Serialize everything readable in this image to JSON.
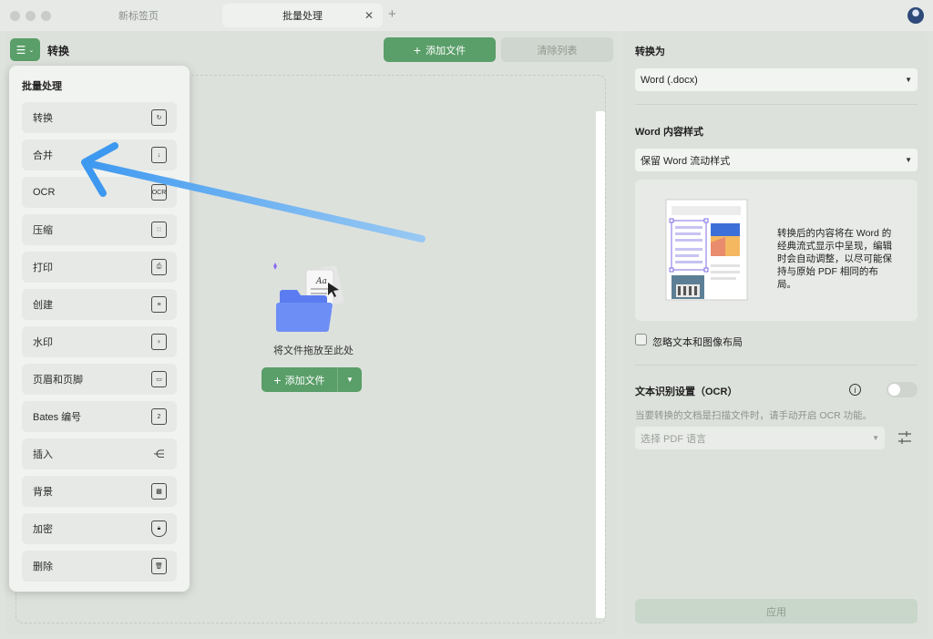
{
  "titlebar": {
    "tabs": [
      {
        "label": "新标签页",
        "active": false
      },
      {
        "label": "批量处理",
        "active": true
      }
    ]
  },
  "toolbar": {
    "title": "转换",
    "add_files_label": "添加文件",
    "clear_list_label": "清除列表"
  },
  "dropzone": {
    "hint": "将文件拖放至此处",
    "add_files_label": "添加文件"
  },
  "menu": {
    "heading": "批量处理",
    "items": [
      {
        "label": "转换",
        "icon": "convert-icon"
      },
      {
        "label": "合并",
        "icon": "merge-icon"
      },
      {
        "label": "OCR",
        "icon": "ocr-icon",
        "icon_text": "OCR"
      },
      {
        "label": "压缩",
        "icon": "compress-icon"
      },
      {
        "label": "打印",
        "icon": "print-icon"
      },
      {
        "label": "创建",
        "icon": "create-icon"
      },
      {
        "label": "水印",
        "icon": "watermark-icon"
      },
      {
        "label": "页眉和页脚",
        "icon": "header-footer-icon"
      },
      {
        "label": "Bates 编号",
        "icon": "bates-icon",
        "icon_text": "2"
      },
      {
        "label": "插入",
        "icon": "insert-icon"
      },
      {
        "label": "背景",
        "icon": "background-icon"
      },
      {
        "label": "加密",
        "icon": "encrypt-icon"
      },
      {
        "label": "删除",
        "icon": "delete-icon"
      }
    ]
  },
  "settings": {
    "convert_to_label": "转换为",
    "convert_to_value": "Word (.docx)",
    "word_style_label": "Word 内容样式",
    "word_style_value": "保留 Word 流动样式",
    "preview_description": "转换后的内容将在 Word 的经典流式显示中呈现，编辑时会自动调整，以尽可能保持与原始 PDF 相同的布局。",
    "ignore_layout_label": "忽略文本和图像布局",
    "ignore_layout_checked": false,
    "ocr_label": "文本识别设置（OCR）",
    "ocr_enabled": false,
    "ocr_hint": "当要转换的文档是扫描文件时，请手动开启 OCR 功能。",
    "ocr_language_placeholder": "选择 PDF 语言",
    "apply_label": "应用"
  },
  "colors": {
    "accent": "#5a9e69",
    "arrow": "#4da3f0"
  }
}
